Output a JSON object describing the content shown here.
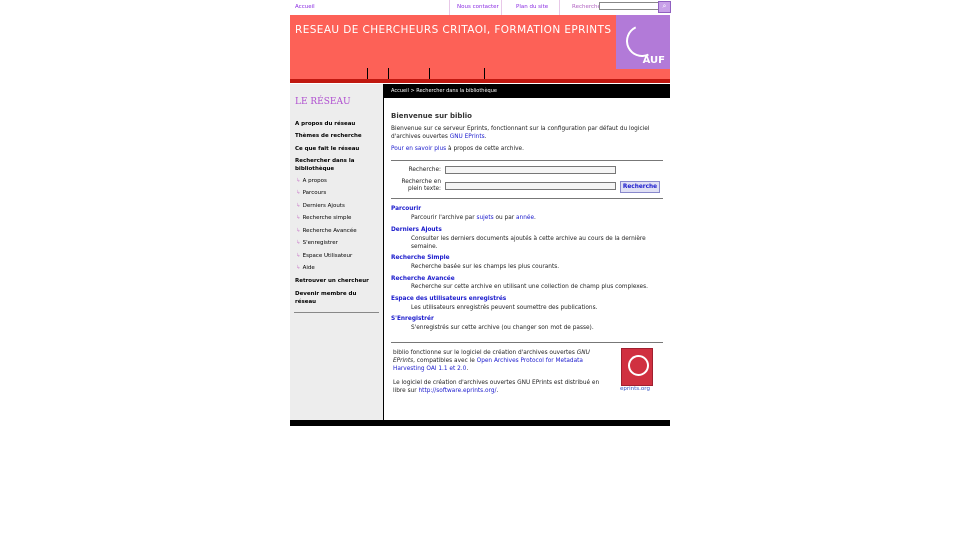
{
  "topbar": {
    "home": "Accueil",
    "contact": "Nous contacter",
    "sitemap": "Plan du site",
    "search": "Recherche",
    "search_btn": "⌕"
  },
  "banner": {
    "title": "RESEAU DE CHERCHEURS CRITAOI, FORMATION EPRINTS",
    "logo_text": "AUF"
  },
  "breadcrumb": "Accueil  > Rechercher dans la bibliothèque",
  "sidebar": {
    "title": "LE RÉSEAU",
    "items": [
      "A propos du réseau",
      "Thèmes de recherche",
      "Ce que fait le réseau",
      "Rechercher dans la bibliothèque"
    ],
    "subitems": [
      "A propos",
      "Parcours",
      "Derniers Ajouts",
      "Recherche simple",
      "Recherche Avancée",
      "S'enregistrer",
      "Espace Utilisateur",
      "Aide"
    ],
    "items2": [
      "Retrouver un chercheur",
      "Devenir membre du réseau"
    ]
  },
  "main": {
    "welcome": "Bienvenue sur biblio",
    "intro_a": "Bienvenue sur ce serveur Eprints, fonctionnant sur la configuration par défaut du logiciel d'archives ouvertes ",
    "intro_link": "GNU EPrints",
    "intro_b": ".",
    "more_link": "Pour en savoir plus",
    "more_b": " à propos de cette archive.",
    "search_label": "Recherche:",
    "fulltext_label": "Recherche en plein texte:",
    "search_button": "Recherche",
    "sections": [
      {
        "title": "Parcourir"
      },
      {
        "title": "Derniers Ajouts",
        "desc": "Consulter les derniers documents ajoutés à cette archive au cours de la dernière semaine."
      },
      {
        "title": "Recherche Simple",
        "desc": "Recherche basée sur les champs les plus courants."
      },
      {
        "title": "Recherche Avancée",
        "desc": "Recherche sur cette archive en utilisant une collection de champ plus complexes."
      },
      {
        "title": "Espace des utilisateurs enregistrés",
        "desc": "Les utilisateurs enregistrés peuvent soumettre des publications."
      },
      {
        "title": "S'Enregistrér",
        "desc": "S'enregistrés sur cette archive (ou changer son mot de passe)."
      }
    ],
    "browse_a": "Parcourir l'archive par ",
    "browse_l1": "sujets",
    "browse_b": " ou par ",
    "browse_l2": "année",
    "browse_c": ".",
    "foot_a": "biblio fonctionne sur le logiciel de création d'archives ouvertes ",
    "foot_em": "GNU EPrints",
    "foot_b": ", compatibles avec le ",
    "foot_link": "Open Archives Protocol for Metadata Harvesting OAI 1.1 et 2.0",
    "foot_c": ".",
    "foot2_a": "Le logiciel de création d'archives ouvertes GNU EPrints est distribué en libre sur ",
    "foot2_link": "http://software.eprints.org/",
    "foot2_b": ".",
    "logo_caption": "eprints.org"
  },
  "colors": {
    "banner": "#fd6157",
    "logo": "#b27ad8",
    "link": "#1a1acc",
    "sidebar": "#ededed"
  }
}
